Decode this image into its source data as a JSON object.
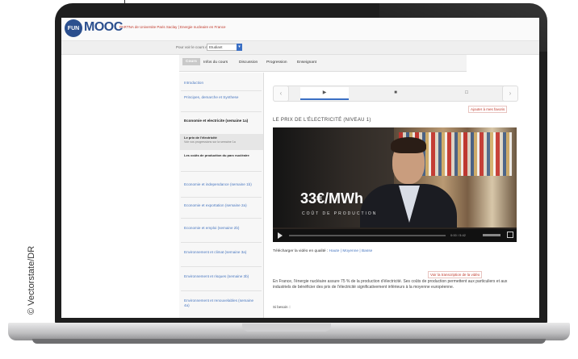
{
  "credit": "© Vectorstate/DR",
  "header": {
    "logo_badge": "FUN",
    "logo_text": "MOOC",
    "school": "PARTNA de Universite Paris Saclay | Energie nucleaire en France"
  },
  "view": {
    "label": "Pour voir le cours en tant que :",
    "select_value": "Etudiant"
  },
  "course_tabs": [
    "Cours",
    "Infos du cours",
    "Discussion",
    "Progression",
    "Enseignant"
  ],
  "sidebar": {
    "items": [
      "Introduction",
      "Principes, demarche et Synthese",
      "Economie et electricite (semaine 1a)",
      "Le prix de l'électricité",
      "Les coûts de production du parc nucléaire",
      "Economie et independance (semaine 1b)",
      "Economie et exportation (semaine 2a)",
      "Economie et emploi (semaine 2b)",
      "Environnement et climat (semaine 3a)",
      "Environnement et risques (semaine 3b)",
      "Environnement et renouvelables (semaine 4a)"
    ],
    "active_sub": "Voir vos progressions sur la semaine 1a"
  },
  "sequence": {
    "prev": "‹",
    "next": "›",
    "cells": [
      "▶",
      "■",
      "□"
    ]
  },
  "bookmark_label": "Ajouter à mes favoris",
  "video": {
    "title": "LE PRIX DE L'ÉLECTRICITÉ (NIVEAU 1)",
    "price": "33€/MWh",
    "price_sub": "COÛT DE PRODUCTION",
    "time": "0:00 / 5:42"
  },
  "download": {
    "label": "Télécharger la vidéo en qualité :",
    "link": "Haute | Moyenne | Basse"
  },
  "transcript_link": "Voir la transcription de la vidéo",
  "paragraph": "En France, l'énergie nucléaire assure 75 % de la production d'électricité. Ses coûts de production permettent aux particuliers et aux industriels de bénéficier des prix de l'électricité significativement inférieurs à la moyenne européenne.",
  "more": "Si besoin ::"
}
